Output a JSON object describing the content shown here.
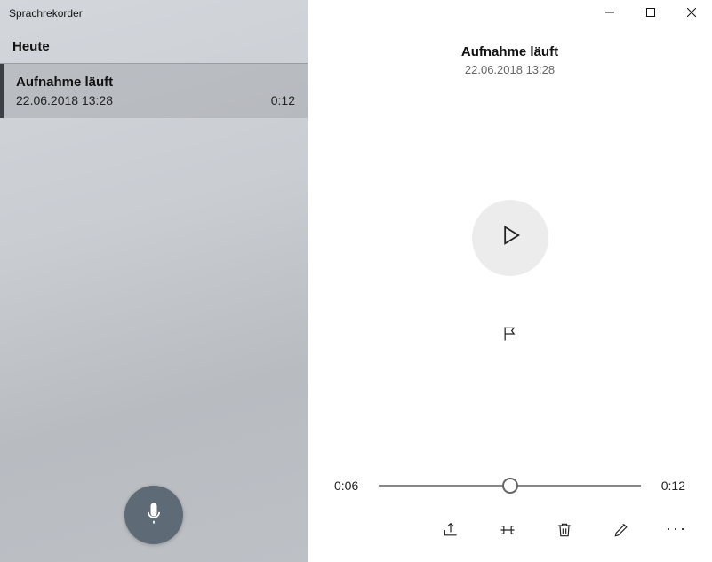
{
  "app_title": "Sprachrekorder",
  "sidebar": {
    "section_header": "Heute",
    "recordings": [
      {
        "title": "Aufnahme läuft",
        "datetime": "22.06.2018 13:28",
        "duration": "0:12"
      }
    ]
  },
  "detail": {
    "title": "Aufnahme läuft",
    "datetime": "22.06.2018 13:28"
  },
  "playback": {
    "current_time": "0:06",
    "total_time": "0:12",
    "progress_percent": 50
  }
}
